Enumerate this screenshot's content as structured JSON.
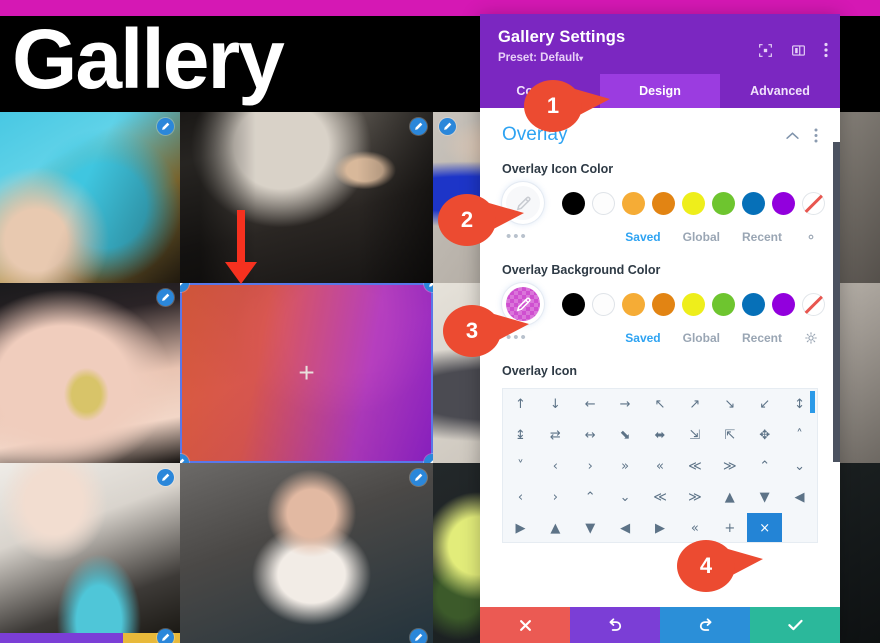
{
  "site": {
    "hero_title": "Gallery",
    "background_color": "#d818b6",
    "hero_bg": "#000000"
  },
  "gallery": {
    "edit_icon": "pencil-icon",
    "selected_overlay_icon": "plus-icon",
    "annotation_arrow": "red-down-arrow",
    "tiles": [
      {
        "id": "tile-bike",
        "alt": "Teal bicycle frame close-up"
      },
      {
        "id": "tile-barber",
        "alt": "Barber leaning on chair in shop"
      },
      {
        "id": "tile-bluecoat",
        "alt": "Person in blue jacket"
      },
      {
        "id": "tile-hands",
        "alt": "Hands holding a cracker"
      },
      {
        "id": "tile-portrait",
        "alt": "Portrait of woman - selected with overlay"
      },
      {
        "id": "tile-skate",
        "alt": "Skateboard and sneakers"
      },
      {
        "id": "tile-stretch",
        "alt": "Woman stretching with band"
      },
      {
        "id": "tile-dumbbell",
        "alt": "Woman lifting dumbbells"
      },
      {
        "id": "tile-lime",
        "alt": "Lime and ice cubes on dark surface"
      }
    ]
  },
  "panel": {
    "title": "Gallery Settings",
    "preset_label": "Preset: Default",
    "preset_caret": "▾",
    "header_icons": [
      {
        "name": "fullscreen-icon"
      },
      {
        "name": "layout-columns-icon"
      },
      {
        "name": "kebab-menu-icon"
      }
    ],
    "tabs": [
      {
        "label": "Content",
        "active": false
      },
      {
        "label": "Design",
        "active": true
      },
      {
        "label": "Advanced",
        "active": false
      }
    ],
    "section": {
      "title": "Overlay",
      "collapse_icon": "chevron-up-icon",
      "menu_icon": "kebab-menu-icon"
    },
    "fields": [
      {
        "label": "Overlay Icon Color",
        "swatch_style": "white",
        "swatch_icon": "eyedropper-icon",
        "more_dots": "•••",
        "palette": [
          "#000000",
          "#ffffff",
          "#f5ac36",
          "#e28413",
          "#eeee1b",
          "#6ec52f",
          "#0670b8",
          "#9200dd",
          "none"
        ],
        "links": [
          {
            "label": "Saved",
            "active": true
          },
          {
            "label": "Global",
            "active": false
          },
          {
            "label": "Recent",
            "active": false
          }
        ],
        "settings_icon": "gear-icon"
      },
      {
        "label": "Overlay Background Color",
        "swatch_style": "pink-checker",
        "swatch_color": "#cf4fd0",
        "swatch_icon": "eyedropper-icon",
        "more_dots": "•••",
        "palette": [
          "#000000",
          "#ffffff",
          "#f5ac36",
          "#e28413",
          "#eeee1b",
          "#6ec52f",
          "#0670b8",
          "#9200dd",
          "none"
        ],
        "links": [
          {
            "label": "Saved",
            "active": true
          },
          {
            "label": "Global",
            "active": false
          },
          {
            "label": "Recent",
            "active": false
          }
        ],
        "settings_icon": "gear-icon"
      }
    ],
    "icon_picker": {
      "label": "Overlay Icon",
      "selected_index": 43,
      "glyphs": [
        "↑",
        "↓",
        "←",
        "→",
        "↖",
        "↗",
        "↘",
        "↙",
        "↕",
        "↨",
        "⇄",
        "↔",
        "⬊",
        "⬌",
        "⇲",
        "⇱",
        "✥",
        "˄",
        "˅",
        "‹",
        "›",
        "»",
        "«",
        "≪",
        "≫",
        "⌃",
        "⌄",
        "‹",
        "›",
        "⌃",
        "⌄",
        "≪",
        "≫",
        "▲",
        "▼",
        "◀",
        "▶",
        "▲",
        "▼",
        "◀",
        "▶",
        "«",
        "+",
        "×"
      ]
    },
    "actions": [
      {
        "name": "cancel-button",
        "icon": "close-icon",
        "color": "#eb5a53"
      },
      {
        "name": "undo-button",
        "icon": "undo-icon",
        "color": "#7b3ed6"
      },
      {
        "name": "redo-button",
        "icon": "redo-icon",
        "color": "#2b8fd8"
      },
      {
        "name": "save-button",
        "icon": "check-icon",
        "color": "#2bb89b"
      }
    ]
  },
  "callouts": [
    {
      "number": "1",
      "target": "design-tab"
    },
    {
      "number": "2",
      "target": "overlay-icon-color-swatch"
    },
    {
      "number": "3",
      "target": "overlay-background-color-swatch"
    },
    {
      "number": "4",
      "target": "plus-icon-in-picker"
    }
  ]
}
